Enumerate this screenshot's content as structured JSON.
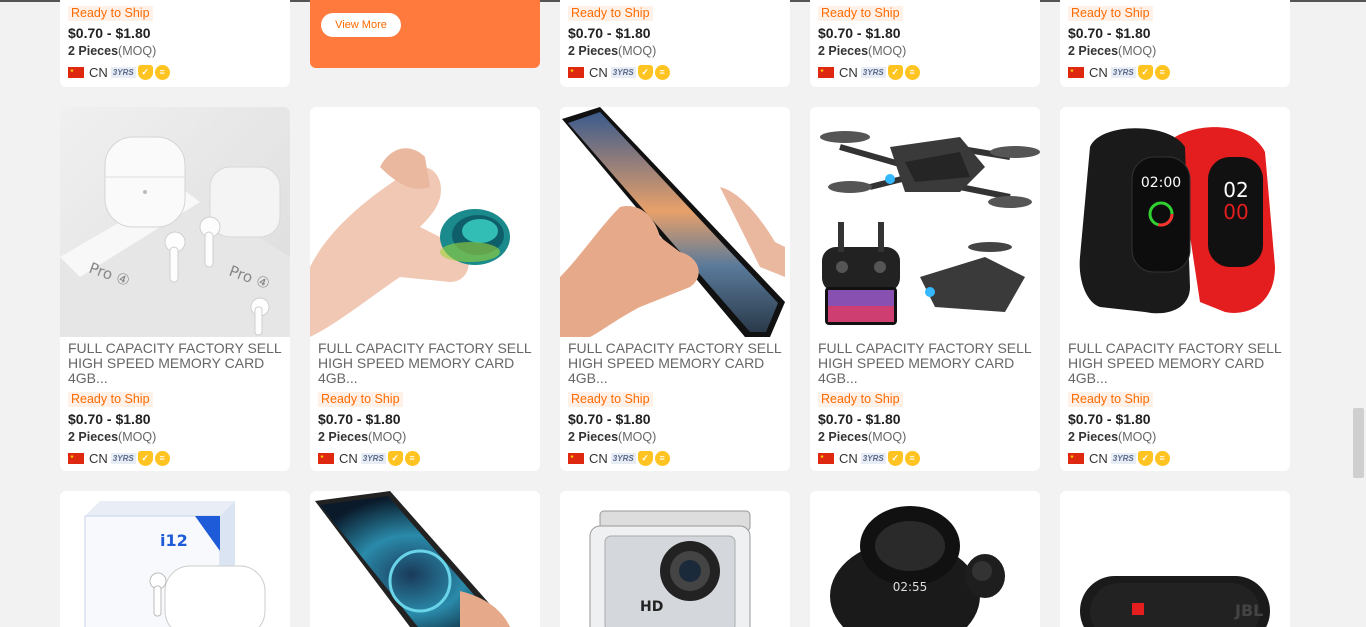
{
  "view_more_label": "View More",
  "top_row": [
    {
      "ready": "Ready to Ship",
      "price": "$0.70 - $1.80",
      "moq_qty": "2 Pieces",
      "moq_unit": "(MOQ)",
      "country": "CN",
      "years": "3YRS"
    },
    {
      "ready": "Ready to Ship",
      "price": "$0.70 - $1.80",
      "moq_qty": "2 Pieces",
      "moq_unit": "(MOQ)",
      "country": "CN",
      "years": "3YRS"
    },
    {
      "ready": "Ready to Ship",
      "price": "$0.70 - $1.80",
      "moq_qty": "2 Pieces",
      "moq_unit": "(MOQ)",
      "country": "CN",
      "years": "3YRS"
    },
    {
      "ready": "Ready to Ship",
      "price": "$0.70 - $1.80",
      "moq_qty": "2 Pieces",
      "moq_unit": "(MOQ)",
      "country": "CN",
      "years": "3YRS"
    }
  ],
  "mid_row": [
    {
      "image": "earbuds-pro4",
      "title": "FULL CAPACITY FACTORY SELL HIGH SPEED MEMORY CARD 4GB...",
      "ready": "Ready to Ship",
      "price": "$0.70 - $1.80",
      "moq_qty": "2 Pieces",
      "moq_unit": "(MOQ)",
      "country": "CN",
      "years": "3YRS"
    },
    {
      "image": "mini-speaker",
      "title": "FULL CAPACITY FACTORY SELL HIGH SPEED MEMORY CARD 4GB...",
      "ready": "Ready to Ship",
      "price": "$0.70 - $1.80",
      "moq_qty": "2 Pieces",
      "moq_unit": "(MOQ)",
      "country": "CN",
      "years": "3YRS"
    },
    {
      "image": "smartphone",
      "title": "FULL CAPACITY FACTORY SELL HIGH SPEED MEMORY CARD 4GB...",
      "ready": "Ready to Ship",
      "price": "$0.70 - $1.80",
      "moq_qty": "2 Pieces",
      "moq_unit": "(MOQ)",
      "country": "CN",
      "years": "3YRS"
    },
    {
      "image": "drone",
      "title": "FULL CAPACITY FACTORY SELL HIGH SPEED MEMORY CARD 4GB...",
      "ready": "Ready to Ship",
      "price": "$0.70 - $1.80",
      "moq_qty": "2 Pieces",
      "moq_unit": "(MOQ)",
      "country": "CN",
      "years": "3YRS"
    },
    {
      "image": "fitness-band",
      "title": "FULL CAPACITY FACTORY SELL HIGH SPEED MEMORY CARD 4GB...",
      "ready": "Ready to Ship",
      "price": "$0.70 - $1.80",
      "moq_qty": "2 Pieces",
      "moq_unit": "(MOQ)",
      "country": "CN",
      "years": "3YRS"
    }
  ],
  "bottom_row": [
    {
      "image": "i12-earbuds",
      "box_text": "i12"
    },
    {
      "image": "smartphone-2"
    },
    {
      "image": "action-camera",
      "box_text": "HD"
    },
    {
      "image": "wireless-earbuds"
    },
    {
      "image": "bluetooth-speaker"
    }
  ],
  "colors": {
    "accent": "#ff6a00",
    "banner": "#ff7a3c",
    "background": "#f2f2f2"
  }
}
